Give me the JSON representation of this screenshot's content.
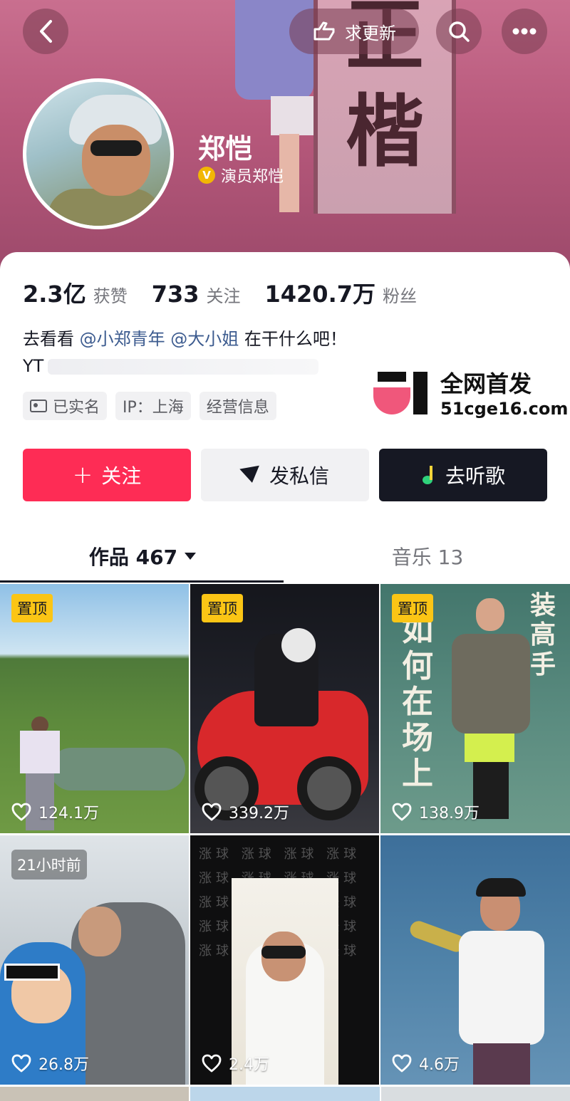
{
  "header": {
    "update_label": "求更新",
    "banner_glyphs": [
      "正",
      "楷"
    ]
  },
  "profile": {
    "name": "郑恺",
    "verify_badge": "V",
    "verify_text": "演员郑恺"
  },
  "stats": [
    {
      "num": "2.3亿",
      "label": "获赞"
    },
    {
      "num": "733",
      "label": "关注"
    },
    {
      "num": "1420.7万",
      "label": "粉丝"
    }
  ],
  "bio": {
    "prefix": "去看看 ",
    "mention1": "@小郑青年",
    "mention2": "@大小姐",
    "suffix": " 在干什么吧！",
    "line2": "YT"
  },
  "tags": [
    "已实名",
    "IP：上海",
    "经营信息"
  ],
  "watermark": {
    "line1": "全网首发",
    "line2": "51cge16.com"
  },
  "actions": {
    "follow": "关注",
    "follow_plus": "+",
    "message": "发私信",
    "music": "去听歌"
  },
  "tabs": {
    "works": "作品 467",
    "music": "音乐 13"
  },
  "grid": [
    {
      "badge": "置顶",
      "likes": "124.1万"
    },
    {
      "badge": "置顶",
      "likes": "339.2万"
    },
    {
      "badge": "置顶",
      "likes": "138.9万",
      "calligraphy": "如何在场上",
      "calligraphy2": "装高手"
    },
    {
      "time": "21小时前",
      "likes": "26.8万"
    },
    {
      "likes": "2.4万",
      "overlay_text": "涨球 涨球 涨球 涨球 涨球 涨球 涨球 涨球 涨球 涨球 涨球 涨球 涨球 涨球 涨球 涨球 涨球 涨球 涨球 涨球"
    },
    {
      "likes": "4.6万"
    }
  ],
  "colors": {
    "follow": "#fe2c55",
    "dark_button": "#161823",
    "pin_badge": "#fbc515",
    "mention": "#3c5b8f"
  },
  "icons": [
    "back-icon",
    "hand-pointer-icon",
    "search-icon",
    "more-icon",
    "verified-icon",
    "id-card-icon",
    "plus-icon",
    "send-icon",
    "music-note-icon",
    "caret-down-icon",
    "heart-icon"
  ]
}
